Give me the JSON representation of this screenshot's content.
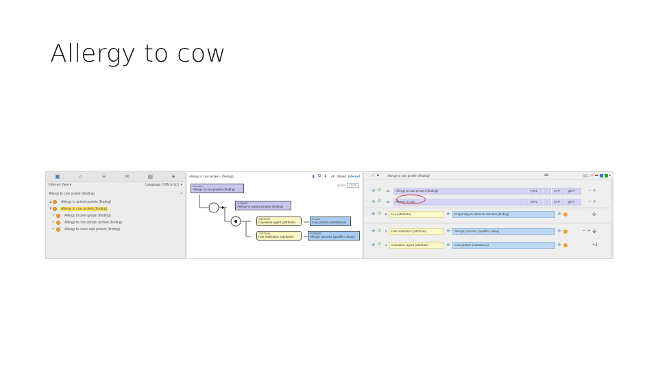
{
  "slide": {
    "title": "Allergy to cow"
  },
  "taxonomy": {
    "tabs": [
      "hierarchy-icon",
      "search-icon",
      "list-icon",
      "inbox-icon",
      "document-icon",
      "info-icon"
    ],
    "view_label": "Inferred View",
    "language_label": "Language:",
    "language_value": "FSN in US",
    "focus": "Allergy to cow protein (finding)",
    "close": "×",
    "tree": [
      {
        "label": "Allergy to animal protein (finding)",
        "toggle": "▲",
        "selected": false,
        "child": false
      },
      {
        "label": "Allergy to cow protein (finding)",
        "toggle": "▼",
        "selected": true,
        "child": false
      },
      {
        "label": "Allergy to beef gelatin (finding)",
        "toggle": "+",
        "selected": false,
        "child": true
      },
      {
        "label": "Allergy to cow dander protein (finding)",
        "toggle": "+",
        "selected": false,
        "child": true
      },
      {
        "label": "Allergy to cow's milk protein (finding)",
        "toggle": "+",
        "selected": false,
        "child": true
      }
    ]
  },
  "diagram": {
    "title": "Allergy to cow protein - (finding)",
    "toggles": {
      "af": "AF",
      "stated": "Stated",
      "inferred": "Inferred"
    },
    "zoom_label": "zoom",
    "zoom_value": "100%",
    "nodes": {
      "root": {
        "code": "Fxxxxxxxx",
        "label": "Allergy to cow protein (finding)"
      },
      "parent": {
        "code": "41780009",
        "label": "Allergy to animal protein (finding)"
      },
      "causative": {
        "code": "246075003",
        "label": "Causative agent (attribute)"
      },
      "cow_protein": {
        "code": "Pxxxxxx",
        "label": "Cow protein (substance)"
      },
      "has_realization": {
        "code": "719722006",
        "label": "Has realization (attribute)"
      },
      "allergic_process": {
        "code": "472964009",
        "label": "Allergic process (qualifier value)"
      }
    },
    "operators": {
      "equiv": "≡",
      "conj": "●"
    }
  },
  "editor": {
    "title": "Allergy to cow protein (finding)",
    "descriptions": [
      {
        "lang": "us",
        "text": "Allergy to cow protein (finding)",
        "type": "FSN",
        "dash": "-",
        "case": "cs P",
        "accept": "gb P"
      },
      {
        "lang": "us",
        "text": "Allergy to cow",
        "type": "SYN",
        "dash": "-",
        "case": "cs P",
        "accept": "gb P"
      }
    ],
    "relationships": [
      {
        "group": "0",
        "attr": "Is a (attribute)",
        "value": "Propensity to adverse reaction (finding)"
      },
      {
        "group": "1",
        "attr": "Has realization (attribute)",
        "value": "Allergic process (qualifier value)"
      },
      {
        "group": "1",
        "attr": "Causative agent (attribute)",
        "value": "Cow protein (substance)"
      }
    ],
    "controls": {
      "minus": "−",
      "plus": "+",
      "plus_one": "+1",
      "move": "✣"
    }
  }
}
